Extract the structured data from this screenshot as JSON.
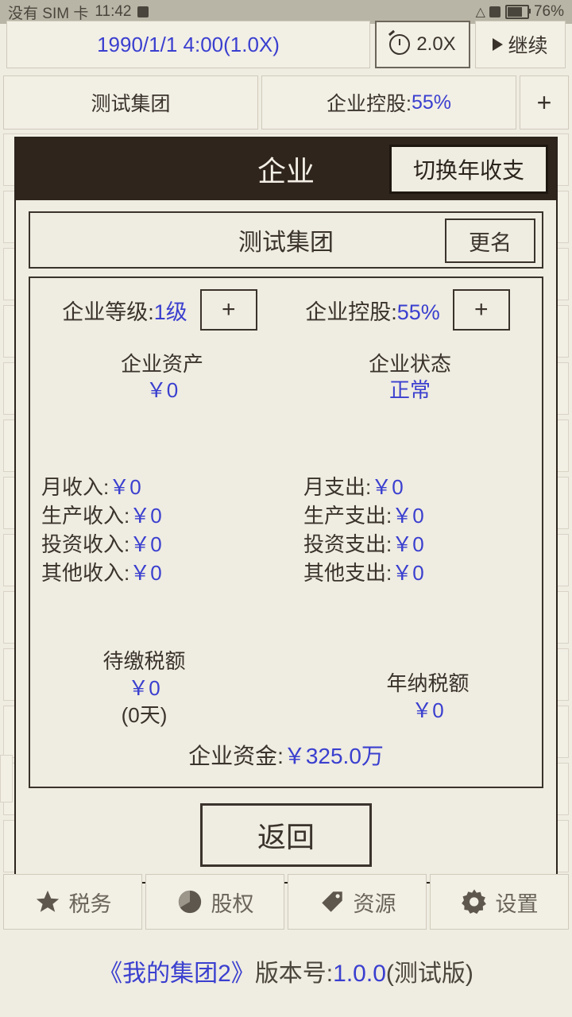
{
  "statusbar": {
    "carrier": "没有 SIM 卡",
    "time": "11:42",
    "battery": "76%",
    "wifi_icon": "wifi-icon",
    "battery_icon": "battery-icon",
    "sim_icon": "sim-card-icon"
  },
  "topbar": {
    "date": "1990/1/1 4:00(1.0X)",
    "speed": "2.0X",
    "speed_icon": "stopwatch-icon",
    "continue": "继续",
    "play_icon": "play-icon"
  },
  "tabs": {
    "group_name": "测试集团",
    "holding_label": "企业控股:",
    "holding_value": "55%",
    "add": "+"
  },
  "modal": {
    "title": "企业",
    "switch_button": "切换年收支",
    "company_name": "测试集团",
    "rename_button": "更名",
    "level_label": "企业等级:",
    "level_value": "1级",
    "level_add": "+",
    "holding_label": "企业控股:",
    "holding_value": "55%",
    "holding_add": "+",
    "assets_label": "企业资产",
    "assets_value": "￥0",
    "status_label": "企业状态",
    "status_value": "正常",
    "income": [
      {
        "label": "月收入:",
        "value": "￥0"
      },
      {
        "label": "生产收入:",
        "value": "￥0"
      },
      {
        "label": "投资收入:",
        "value": "￥0"
      },
      {
        "label": "其他收入:",
        "value": "￥0"
      }
    ],
    "expense": [
      {
        "label": "月支出:",
        "value": "￥0"
      },
      {
        "label": "生产支出:",
        "value": "￥0"
      },
      {
        "label": "投资支出:",
        "value": "￥0"
      },
      {
        "label": "其他支出:",
        "value": "￥0"
      }
    ],
    "tax_due_label": "待缴税额",
    "tax_due_value": "￥0",
    "tax_due_days": "(0天)",
    "tax_year_label": "年纳税额",
    "tax_year_value": "￥0",
    "funds_label": "企业资金:",
    "funds_value": "￥325.0万",
    "back_button": "返回"
  },
  "bottomnav": [
    {
      "label": "税务",
      "icon": "star-icon"
    },
    {
      "label": "股权",
      "icon": "pie-chart-icon"
    },
    {
      "label": "资源",
      "icon": "tag-icon"
    },
    {
      "label": "设置",
      "icon": "gear-icon"
    }
  ],
  "footer": {
    "title": "《我的集团2》",
    "version_label": "版本号:",
    "version": "1.0.0",
    "build": "(测试版)"
  }
}
